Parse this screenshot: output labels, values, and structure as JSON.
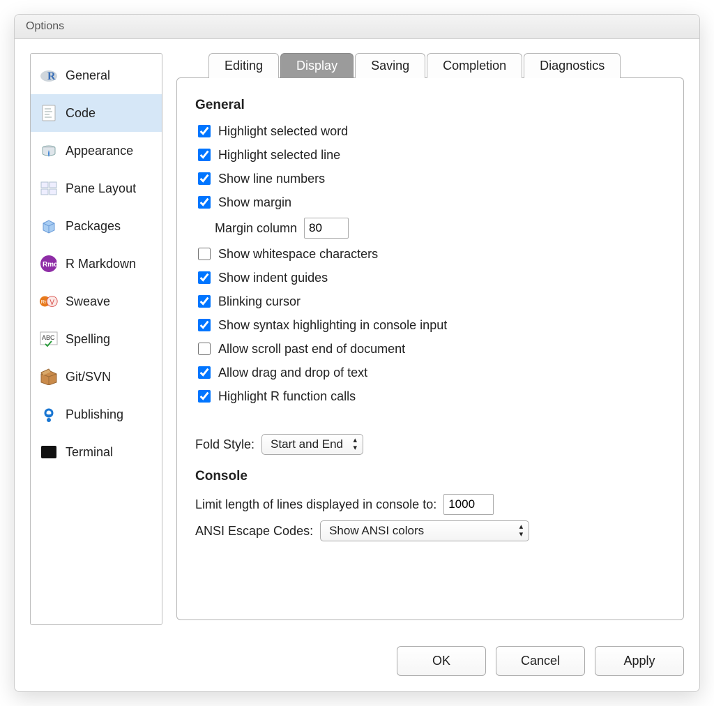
{
  "title": "Options",
  "sidebar": {
    "items": [
      {
        "label": "General"
      },
      {
        "label": "Code"
      },
      {
        "label": "Appearance"
      },
      {
        "label": "Pane Layout"
      },
      {
        "label": "Packages"
      },
      {
        "label": "R Markdown"
      },
      {
        "label": "Sweave"
      },
      {
        "label": "Spelling"
      },
      {
        "label": "Git/SVN"
      },
      {
        "label": "Publishing"
      },
      {
        "label": "Terminal"
      }
    ],
    "active_index": 1
  },
  "tabs": {
    "items": [
      "Editing",
      "Display",
      "Saving",
      "Completion",
      "Diagnostics"
    ],
    "active_index": 1
  },
  "sections": {
    "general_heading": "General",
    "console_heading": "Console"
  },
  "opts": {
    "highlight_selected_word": "Highlight selected word",
    "highlight_selected_line": "Highlight selected line",
    "show_line_numbers": "Show line numbers",
    "show_margin": "Show margin",
    "margin_column_label": "Margin column",
    "margin_column_value": "80",
    "show_whitespace": "Show whitespace characters",
    "show_indent_guides": "Show indent guides",
    "blinking_cursor": "Blinking cursor",
    "syntax_console": "Show syntax highlighting in console input",
    "scroll_past_end": "Allow scroll past end of document",
    "drag_drop": "Allow drag and drop of text",
    "highlight_r_calls": "Highlight R function calls",
    "fold_style_label": "Fold Style:",
    "fold_style_value": "Start and End",
    "console_limit_label": "Limit length of lines displayed in console to:",
    "console_limit_value": "1000",
    "ansi_label": "ANSI Escape Codes:",
    "ansi_value": "Show ANSI colors"
  },
  "buttons": {
    "ok": "OK",
    "cancel": "Cancel",
    "apply": "Apply"
  }
}
